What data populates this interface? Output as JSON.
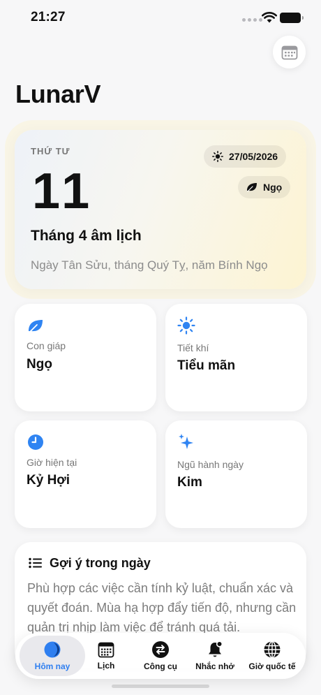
{
  "status_bar": {
    "time": "21:27"
  },
  "header": {
    "title": "LunarV",
    "calendar_icon": "calendar-icon"
  },
  "day_card": {
    "weekday": "THỨ TƯ",
    "day": "11",
    "lunar_month": "Tháng 4 âm lịch",
    "can_chi": "Ngày Tân Sửu, tháng Quý Tỵ, năm Bính Ngọ",
    "solar_date": "27/05/2026",
    "zodiac": "Ngọ"
  },
  "tiles": [
    {
      "label": "Con giáp",
      "value": "Ngọ",
      "icon": "leaf-icon"
    },
    {
      "label": "Tiết khí",
      "value": "Tiểu mãn",
      "icon": "sun-icon"
    },
    {
      "label": "Giờ hiện tại",
      "value": "Kỷ Hợi",
      "icon": "clock-icon"
    },
    {
      "label": "Ngũ hành ngày",
      "value": "Kim",
      "icon": "sparkles-icon"
    }
  ],
  "suggestion": {
    "title": "Gợi ý trong ngày",
    "body": "Phù hợp các việc cần tính kỷ luật, chuẩn xác và quyết đoán. Mùa hạ hợp đẩy tiến độ, nhưng cần quản trị nhịp làm việc để tránh quá tải."
  },
  "tabs": [
    {
      "label": "Hôm nay",
      "icon": "moon-icon",
      "active": true
    },
    {
      "label": "Lịch",
      "icon": "calendar-grid-icon",
      "active": false
    },
    {
      "label": "Công cụ",
      "icon": "arrows-swap-icon",
      "active": false
    },
    {
      "label": "Nhắc nhở",
      "icon": "bell-icon",
      "active": false
    },
    {
      "label": "Giờ quốc tế",
      "icon": "globe-icon",
      "active": false
    }
  ],
  "colors": {
    "accent": "#2f7ff0",
    "tile_icon": "#2f84f2"
  }
}
